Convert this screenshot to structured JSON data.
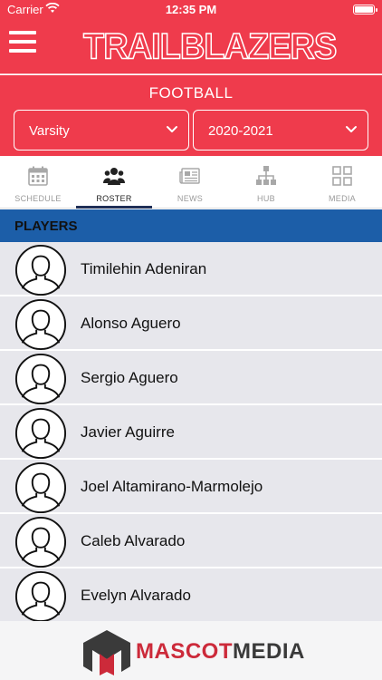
{
  "status_bar": {
    "carrier": "Carrier",
    "time": "12:35 PM"
  },
  "header": {
    "brand": "TRAILBLAZERS",
    "menu_icon": "hamburger-icon"
  },
  "sport": {
    "title": "FOOTBALL",
    "level": {
      "value": "Varsity"
    },
    "season": {
      "value": "2020-2021"
    }
  },
  "tabs": [
    {
      "label": "SCHEDULE",
      "icon": "calendar-icon",
      "active": false
    },
    {
      "label": "ROSTER",
      "icon": "group-icon",
      "active": true
    },
    {
      "label": "NEWS",
      "icon": "newspaper-icon",
      "active": false
    },
    {
      "label": "HUB",
      "icon": "hierarchy-icon",
      "active": false
    },
    {
      "label": "MEDIA",
      "icon": "grid-icon",
      "active": false
    }
  ],
  "section": {
    "title": "PLAYERS"
  },
  "players": [
    {
      "name": "Timilehin Adeniran"
    },
    {
      "name": "Alonso Aguero"
    },
    {
      "name": "Sergio Aguero"
    },
    {
      "name": "Javier Aguirre"
    },
    {
      "name": "Joel Altamirano-Marmolejo"
    },
    {
      "name": "Caleb Alvarado"
    },
    {
      "name": "Evelyn Alvarado"
    }
  ],
  "footer": {
    "logo_part1": "MASCOT",
    "logo_part2": "MEDIA"
  },
  "colors": {
    "primary_red": "#ef3b4c",
    "section_blue": "#1c5ea8",
    "list_bg": "#e7e7ec",
    "tab_active": "#1f2f57"
  }
}
